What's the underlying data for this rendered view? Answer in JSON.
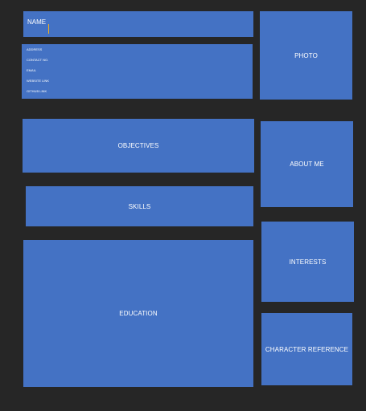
{
  "name_section": {
    "label": "NAME"
  },
  "contact": {
    "items": [
      "ADDRESS",
      "CONTACT NO.",
      "EMAIL",
      "WEBSITE LINK",
      "GITHUB LINK"
    ]
  },
  "sections": {
    "photo": "PHOTO",
    "objectives": "OBJECTIVES",
    "about_me": "ABOUT ME",
    "skills": "SKILLS",
    "interests": "INTERESTS",
    "education": "EDUCATION",
    "character_reference": "CHARACTER REFERENCE"
  },
  "colors": {
    "background": "#262626",
    "box_fill": "#4472c4",
    "text": "#ffffff",
    "caret": "#f0b020"
  }
}
